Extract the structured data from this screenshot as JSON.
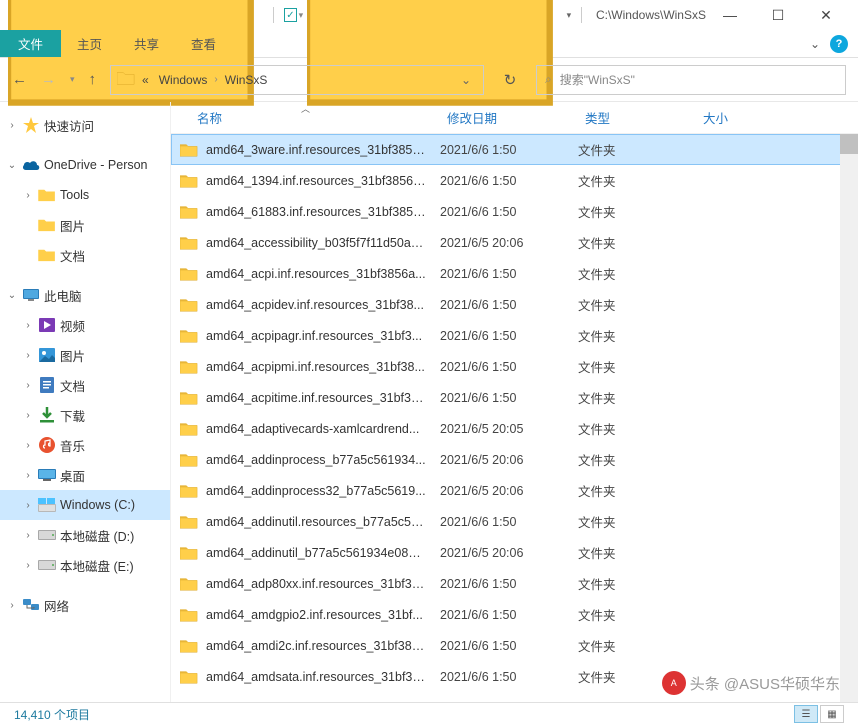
{
  "window": {
    "title": "C:\\Windows\\WinSxS"
  },
  "ribbon": {
    "file": "文件",
    "home": "主页",
    "share": "共享",
    "view": "查看"
  },
  "breadcrumb": {
    "seg1": "Windows",
    "seg2": "WinSxS"
  },
  "search": {
    "placeholder": "搜索\"WinSxS\""
  },
  "columns": {
    "name": "名称",
    "date": "修改日期",
    "type": "类型",
    "size": "大小"
  },
  "nav": {
    "quick": "快速访问",
    "onedrive": "OneDrive - Person",
    "tools": "Tools",
    "picsOd": "图片",
    "docsOd": "文档",
    "thispc": "此电脑",
    "videos": "视频",
    "pics": "图片",
    "docs": "文档",
    "downloads": "下载",
    "music": "音乐",
    "desktop": "桌面",
    "cdrive": "Windows (C:)",
    "ddrive": "本地磁盘 (D:)",
    "edrive": "本地磁盘 (E:)",
    "network": "网络"
  },
  "type_folder": "文件夹",
  "rows": [
    {
      "name": "amd64_3ware.inf.resources_31bf3856...",
      "date": "2021/6/6 1:50",
      "selected": true
    },
    {
      "name": "amd64_1394.inf.resources_31bf3856a...",
      "date": "2021/6/6 1:50"
    },
    {
      "name": "amd64_61883.inf.resources_31bf3856...",
      "date": "2021/6/6 1:50"
    },
    {
      "name": "amd64_accessibility_b03f5f7f11d50a3...",
      "date": "2021/6/5 20:06"
    },
    {
      "name": "amd64_acpi.inf.resources_31bf3856a...",
      "date": "2021/6/6 1:50"
    },
    {
      "name": "amd64_acpidev.inf.resources_31bf38...",
      "date": "2021/6/6 1:50"
    },
    {
      "name": "amd64_acpipagr.inf.resources_31bf3...",
      "date": "2021/6/6 1:50"
    },
    {
      "name": "amd64_acpipmi.inf.resources_31bf38...",
      "date": "2021/6/6 1:50"
    },
    {
      "name": "amd64_acpitime.inf.resources_31bf38...",
      "date": "2021/6/6 1:50"
    },
    {
      "name": "amd64_adaptivecards-xamlcardrend...",
      "date": "2021/6/5 20:05"
    },
    {
      "name": "amd64_addinprocess_b77a5c561934...",
      "date": "2021/6/5 20:06"
    },
    {
      "name": "amd64_addinprocess32_b77a5c5619...",
      "date": "2021/6/5 20:06"
    },
    {
      "name": "amd64_addinutil.resources_b77a5c56...",
      "date": "2021/6/6 1:50"
    },
    {
      "name": "amd64_addinutil_b77a5c561934e089_...",
      "date": "2021/6/5 20:06"
    },
    {
      "name": "amd64_adp80xx.inf.resources_31bf38...",
      "date": "2021/6/6 1:50"
    },
    {
      "name": "amd64_amdgpio2.inf.resources_31bf...",
      "date": "2021/6/6 1:50"
    },
    {
      "name": "amd64_amdi2c.inf.resources_31bf385...",
      "date": "2021/6/6 1:50"
    },
    {
      "name": "amd64_amdsata.inf.resources_31bf38...",
      "date": "2021/6/6 1:50"
    }
  ],
  "status": {
    "count": "14,410 个项目"
  },
  "watermark": "头条 @ASUS华硕华东"
}
